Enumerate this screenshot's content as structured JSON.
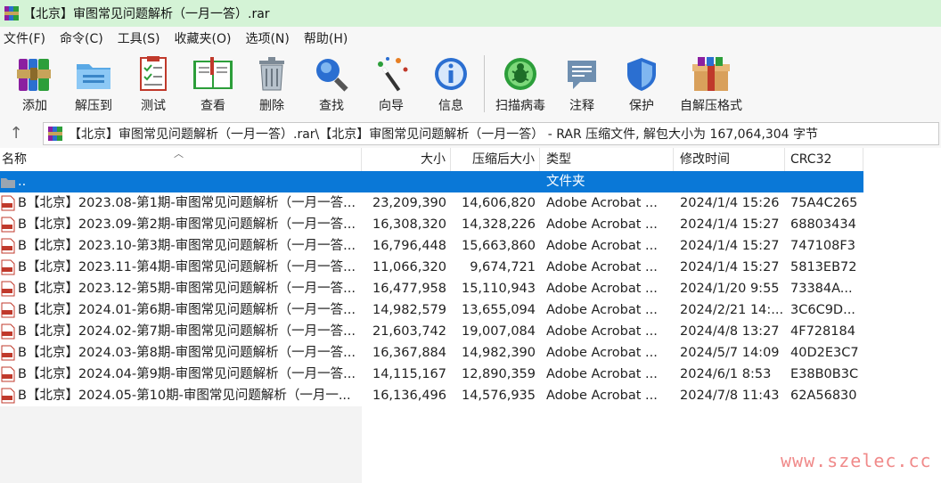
{
  "window": {
    "title": "【北京】审图常见问题解析（一月一答）.rar"
  },
  "menu": [
    "文件(F)",
    "命令(C)",
    "工具(S)",
    "收藏夹(O)",
    "选项(N)",
    "帮助(H)"
  ],
  "toolbar": [
    {
      "label": "添加",
      "icon": "add-archive-icon"
    },
    {
      "label": "解压到",
      "icon": "extract-folder-icon"
    },
    {
      "label": "测试",
      "icon": "test-checklist-icon"
    },
    {
      "label": "查看",
      "icon": "view-book-icon"
    },
    {
      "label": "删除",
      "icon": "trash-icon"
    },
    {
      "label": "查找",
      "icon": "magnifier-icon"
    },
    {
      "label": "向导",
      "icon": "wizard-wand-icon"
    },
    {
      "label": "信息",
      "icon": "info-icon"
    },
    {
      "label": "扫描病毒",
      "icon": "virus-scan-icon"
    },
    {
      "label": "注释",
      "icon": "comment-icon"
    },
    {
      "label": "保护",
      "icon": "shield-icon"
    },
    {
      "label": "自解压格式",
      "icon": "sfx-box-icon"
    }
  ],
  "address": {
    "path": "【北京】审图常见问题解析（一月一答）.rar\\【北京】审图常见问题解析（一月一答）  - RAR 压缩文件, 解包大小为 167,064,304 字节"
  },
  "columns": {
    "name": "名称",
    "size": "大小",
    "packed": "压缩后大小",
    "type": "类型",
    "modified": "修改时间",
    "crc": "CRC32"
  },
  "parent_row": {
    "name": "..",
    "type": "文件夹"
  },
  "files": [
    {
      "name": "B【北京】2023.08-第1期-审图常见问题解析（一月一答...",
      "size": "23,209,390",
      "packed": "14,606,820",
      "type": "Adobe Acrobat ...",
      "modified": "2024/1/4 15:26",
      "crc": "75A4C265"
    },
    {
      "name": "B【北京】2023.09-第2期-审图常见问题解析（一月一答...",
      "size": "16,308,320",
      "packed": "14,328,226",
      "type": "Adobe Acrobat ...",
      "modified": "2024/1/4 15:27",
      "crc": "68803434"
    },
    {
      "name": "B【北京】2023.10-第3期-审图常见问题解析（一月一答...",
      "size": "16,796,448",
      "packed": "15,663,860",
      "type": "Adobe Acrobat ...",
      "modified": "2024/1/4 15:27",
      "crc": "747108F3"
    },
    {
      "name": "B【北京】2023.11-第4期-审图常见问题解析（一月一答...",
      "size": "11,066,320",
      "packed": "9,674,721",
      "type": "Adobe Acrobat ...",
      "modified": "2024/1/4 15:27",
      "crc": "5813EB72"
    },
    {
      "name": "B【北京】2023.12-第5期-审图常见问题解析（一月一答...",
      "size": "16,477,958",
      "packed": "15,110,943",
      "type": "Adobe Acrobat ...",
      "modified": "2024/1/20 9:55",
      "crc": "73384A..."
    },
    {
      "name": "B【北京】2024.01-第6期-审图常见问题解析（一月一答...",
      "size": "14,982,579",
      "packed": "13,655,094",
      "type": "Adobe Acrobat ...",
      "modified": "2024/2/21 14:...",
      "crc": "3C6C9D..."
    },
    {
      "name": "B【北京】2024.02-第7期-审图常见问题解析（一月一答...",
      "size": "21,603,742",
      "packed": "19,007,084",
      "type": "Adobe Acrobat ...",
      "modified": "2024/4/8 13:27",
      "crc": "4F728184"
    },
    {
      "name": "B【北京】2024.03-第8期-审图常见问题解析（一月一答...",
      "size": "16,367,884",
      "packed": "14,982,390",
      "type": "Adobe Acrobat ...",
      "modified": "2024/5/7 14:09",
      "crc": "40D2E3C7"
    },
    {
      "name": "B【北京】2024.04-第9期-审图常见问题解析（一月一答...",
      "size": "14,115,167",
      "packed": "12,890,359",
      "type": "Adobe Acrobat ...",
      "modified": "2024/6/1 8:53",
      "crc": "E38B0B3C"
    },
    {
      "name": "B【北京】2024.05-第10期-审图常见问题解析（一月一...",
      "size": "16,136,496",
      "packed": "14,576,935",
      "type": "Adobe Acrobat ...",
      "modified": "2024/7/8 11:43",
      "crc": "62A56830"
    }
  ],
  "watermark": "www.szelec.cc",
  "colors": {
    "title_bg": "#d4f3d6",
    "selection": "#0a78d7",
    "watermark": "#f08a8a"
  }
}
